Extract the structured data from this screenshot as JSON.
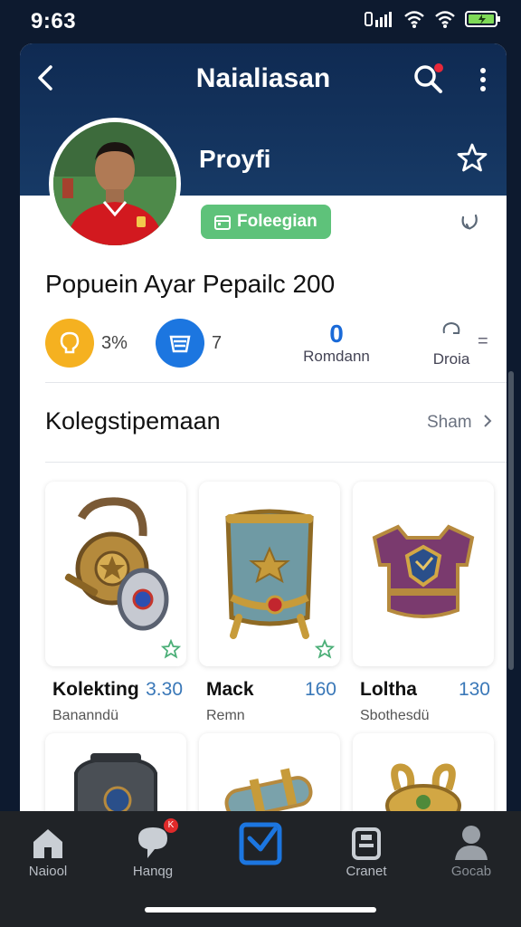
{
  "status_bar": {
    "time": "9:63"
  },
  "header": {
    "title": "Naialiasan",
    "profile_label": "Proyfi"
  },
  "tag": {
    "label": "Foleegian"
  },
  "headline": "Popuein Ayar Pepailc 200",
  "stats": {
    "a_value": "3%",
    "b_value": "7",
    "c_number": "0",
    "c_label": "Romdann",
    "d_label": "Droia",
    "d_suffix": "="
  },
  "section": {
    "title": "Kolegstipemaan",
    "see_all": "Sham"
  },
  "items": [
    {
      "name": "Kolekting",
      "price": "3.30",
      "sub": "Bananndü"
    },
    {
      "name": "Mack",
      "price": "160",
      "sub": "Remn"
    },
    {
      "name": "Loltha",
      "price": "130",
      "sub": "Sbothesdü"
    }
  ],
  "nav": [
    {
      "label": "Naiool"
    },
    {
      "label": "Hanqg",
      "badge": "K"
    },
    {
      "label": ""
    },
    {
      "label": "Cranet"
    },
    {
      "label": "Gocab"
    }
  ],
  "colors": {
    "accent": "#1c76e0",
    "tag": "#5ec27a",
    "price": "#3a78b8",
    "nav_bg": "#202327"
  }
}
